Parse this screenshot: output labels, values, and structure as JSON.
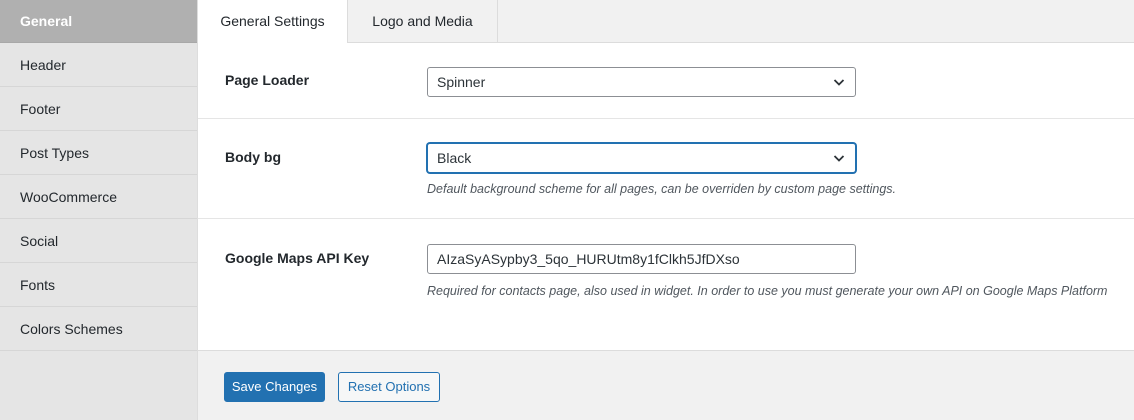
{
  "sidebar": {
    "items": [
      {
        "label": "General"
      },
      {
        "label": "Header"
      },
      {
        "label": "Footer"
      },
      {
        "label": "Post Types"
      },
      {
        "label": "WooCommerce"
      },
      {
        "label": "Social"
      },
      {
        "label": "Fonts"
      },
      {
        "label": "Colors Schemes"
      }
    ],
    "active": "General"
  },
  "tabs": [
    {
      "label": "General Settings"
    },
    {
      "label": "Logo and Media"
    }
  ],
  "fields": {
    "page_loader": {
      "label": "Page Loader",
      "value": "Spinner",
      "icon": "chevron-down-icon"
    },
    "body_bg": {
      "label": "Body bg",
      "value": "Black",
      "icon": "chevron-down-icon",
      "description": "Default background scheme for all pages, can be overriden by custom page settings."
    },
    "google_maps": {
      "label": "Google Maps API Key",
      "value": "AIzaSyASypby3_5qo_HURUtm8y1fClkh5JfDXso",
      "description": "Required for contacts page, also used in widget. In order to use you must generate your own API on Google Maps Platform"
    }
  },
  "buttons": {
    "save": "Save Changes",
    "reset": "Reset Options"
  },
  "colors": {
    "accent": "#2271b1",
    "sidebar_active_bg": "#b0b0b0"
  }
}
